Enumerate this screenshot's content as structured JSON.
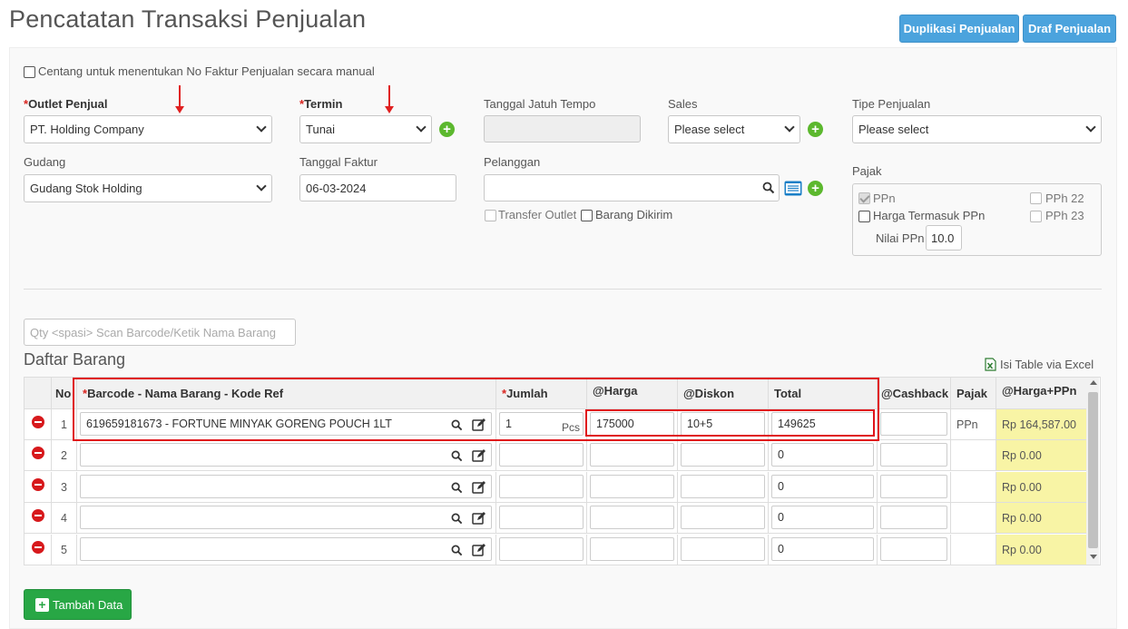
{
  "page": {
    "title": "Pencatatan Transaksi Penjualan",
    "btn_duplikasi": "Duplikasi Penjualan",
    "btn_draf": "Draf Penjualan"
  },
  "form": {
    "manual_checkbox_label": "Centang untuk menentukan No Faktur Penjualan secara manual",
    "outlet_label": "Outlet Penjual",
    "outlet_value": "PT. Holding Company",
    "termin_label": "Termin",
    "termin_value": "Tunai",
    "jatuh_tempo_label": "Tanggal Jatuh Tempo",
    "jatuh_tempo_value": "",
    "sales_label": "Sales",
    "sales_value": "Please select",
    "tipe_label": "Tipe Penjualan",
    "tipe_value": "Please select",
    "gudang_label": "Gudang",
    "gudang_value": "Gudang Stok Holding",
    "tanggal_faktur_label": "Tanggal Faktur",
    "tanggal_faktur_value": "06-03-2024",
    "pelanggan_label": "Pelanggan",
    "pelanggan_value": "",
    "transfer_outlet_label": "Transfer Outlet",
    "barang_dikirim_label": "Barang Dikirim",
    "required_mark": "*"
  },
  "pajak": {
    "label": "Pajak",
    "ppn": "PPn",
    "pph22": "PPh 22",
    "harga_termasuk": "Harga Termasuk PPn",
    "pph23": "PPh 23",
    "nilai_ppn_label": "Nilai PPn",
    "nilai_ppn_value": "10.0"
  },
  "scan": {
    "placeholder": "Qty <spasi> Scan Barcode/Ketik Nama Barang"
  },
  "daftar": {
    "title": "Daftar Barang",
    "excel_link": "Isi Table via Excel"
  },
  "table": {
    "headers": {
      "no": "No",
      "barcode": "Barcode - Nama Barang - Kode Ref",
      "jumlah": "Jumlah",
      "harga": "@Harga",
      "diskon": "@Diskon",
      "total": "Total",
      "cashback": "@Cashback",
      "pajak": "Pajak",
      "harga_ppn": "@Harga+PPn"
    },
    "rows": [
      {
        "no": "1",
        "barang": "619659181673 - FORTUNE MINYAK GORENG POUCH 1LT",
        "jumlah": "1",
        "unit": "Pcs",
        "harga": "175000",
        "diskon": "10+5",
        "total": "149625",
        "cashback": "",
        "pajak": "PPn",
        "harga_ppn": "Rp 164,587.00"
      },
      {
        "no": "2",
        "barang": "",
        "jumlah": "",
        "unit": "",
        "harga": "",
        "diskon": "",
        "total": "0",
        "cashback": "",
        "pajak": "",
        "harga_ppn": "Rp 0.00"
      },
      {
        "no": "3",
        "barang": "",
        "jumlah": "",
        "unit": "",
        "harga": "",
        "diskon": "",
        "total": "0",
        "cashback": "",
        "pajak": "",
        "harga_ppn": "Rp 0.00"
      },
      {
        "no": "4",
        "barang": "",
        "jumlah": "",
        "unit": "",
        "harga": "",
        "diskon": "",
        "total": "0",
        "cashback": "",
        "pajak": "",
        "harga_ppn": "Rp 0.00"
      },
      {
        "no": "5",
        "barang": "",
        "jumlah": "",
        "unit": "",
        "harga": "",
        "diskon": "",
        "total": "0",
        "cashback": "",
        "pajak": "",
        "harga_ppn": "Rp 0.00"
      }
    ]
  },
  "footer": {
    "tambah_label": "Tambah Data",
    "tambah_icon": "+"
  },
  "colors": {
    "primary_button": "#4ba3dd",
    "add_button": "#28a745",
    "highlight_red": "#e0141a",
    "yellow_cell": "#f8f4a5"
  }
}
